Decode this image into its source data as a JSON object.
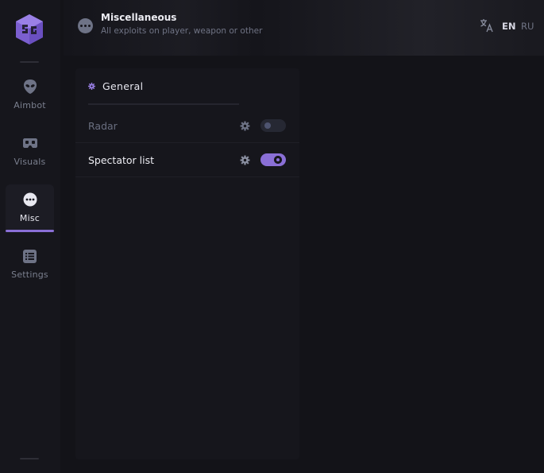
{
  "sidebar": {
    "items": [
      {
        "label": "Aimbot",
        "icon": "alien-icon"
      },
      {
        "label": "Visuals",
        "icon": "vr-headset-icon"
      },
      {
        "label": "Misc",
        "icon": "dots-circle-icon",
        "active": true
      },
      {
        "label": "Settings",
        "icon": "list-icon"
      }
    ]
  },
  "header": {
    "title": "Miscellaneous",
    "subtitle": "All exploits on player, weapon or other"
  },
  "language": {
    "options": [
      "EN",
      "RU"
    ],
    "selected": "EN"
  },
  "panel": {
    "section_title": "General",
    "rows": [
      {
        "label": "Radar",
        "enabled": false
      },
      {
        "label": "Spectator list",
        "enabled": true
      }
    ]
  },
  "colors": {
    "accent": "#8a6fd6",
    "background": "#131318",
    "panel": "#16161c",
    "muted_text": "#6f7384"
  }
}
